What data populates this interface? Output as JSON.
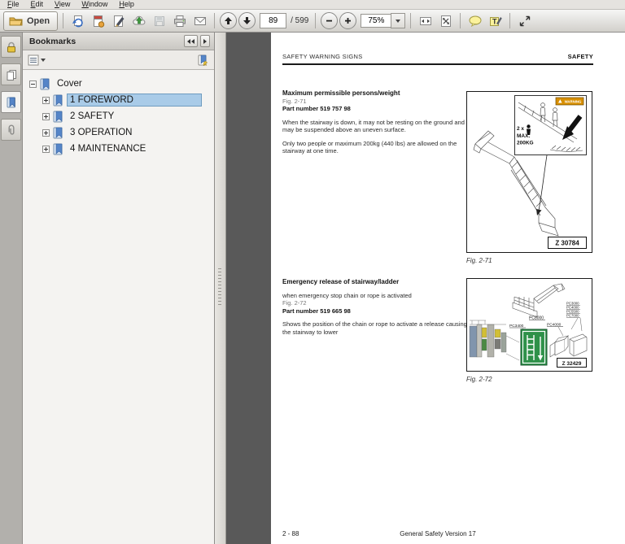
{
  "window": {
    "menu": [
      "File",
      "Edit",
      "View",
      "Window",
      "Help"
    ]
  },
  "toolbar": {
    "open_label": "Open",
    "page_current": "89",
    "page_total_label": "/ 599",
    "zoom_value": "75%",
    "icons": [
      "open-folder-icon",
      "export-page-icon",
      "create-pdf-icon",
      "sign-pen-icon",
      "cloud-upload-icon",
      "save-floppy-icon",
      "print-icon",
      "email-icon",
      "page-up-icon",
      "page-down-icon",
      "zoom-out-icon",
      "zoom-in-icon",
      "zoom-dropdown-icon",
      "fit-width-icon",
      "fit-page-icon",
      "comment-bubble-icon",
      "text-highlight-icon",
      "fullscreen-icon"
    ]
  },
  "sidebar": {
    "title": "Bookmarks",
    "nav_icons": [
      "lock-icon",
      "pages-icon",
      "bookmark-icon",
      "paperclip-icon"
    ],
    "tool_icons": [
      "options-list-icon",
      "new-bookmark-icon"
    ],
    "tree": [
      {
        "label": "Cover",
        "expanded": true,
        "selected": false
      },
      {
        "label": "1 FOREWORD",
        "expanded": false,
        "selected": true
      },
      {
        "label": "2 SAFETY",
        "expanded": false,
        "selected": false
      },
      {
        "label": "3 OPERATION",
        "expanded": false,
        "selected": false
      },
      {
        "label": "4 MAINTENANCE",
        "expanded": false,
        "selected": false
      }
    ]
  },
  "document": {
    "header": {
      "left": "SAFETY WARNING SIGNS",
      "right": "SAFETY"
    },
    "section1": {
      "title": "Maximum permissible persons/weight",
      "fig_ref": "Fig. 2-71",
      "part_number": "Part number 519 757 98",
      "para1": "When the stairway is down, it may not be resting on the ground and may be suspended above an uneven surface.",
      "para2": "Only two people or maximum 200kg (440 lbs) are allowed on the stairway at one time."
    },
    "figure1": {
      "caption": "Fig. 2-71",
      "warning_label": "WARNING",
      "persons_label": "2 x",
      "max_label": "MAX.",
      "weight_label": "200KG",
      "ref_code": "Z 30784"
    },
    "section2": {
      "title": "Emergency release of stairway/ladder",
      "subtitle": "when emergency stop chain or rope is activated",
      "fig_ref": "Fig. 2-72",
      "part_number": "Part number 519 665 98",
      "para1": "Shows the position of the chain or rope to activate a release causing the stairway to lower"
    },
    "figure2": {
      "caption": "Fig. 2-72",
      "machine_top": "PC8000",
      "machine_left_sign": "PC3400",
      "machine_right": "PC4000",
      "machine_group": [
        "PC3000",
        "PC4000",
        "PC5500",
        "PC7000"
      ],
      "ref_code": "Z 32429"
    },
    "footer": {
      "left": "2 - 88",
      "center": "General Safety Version 17"
    }
  },
  "colors": {
    "selection_highlight": "#a9cbe8",
    "doc_background": "#595959",
    "warning_badge": "#d88f00",
    "ladder_sign_green": "#2e9149"
  }
}
